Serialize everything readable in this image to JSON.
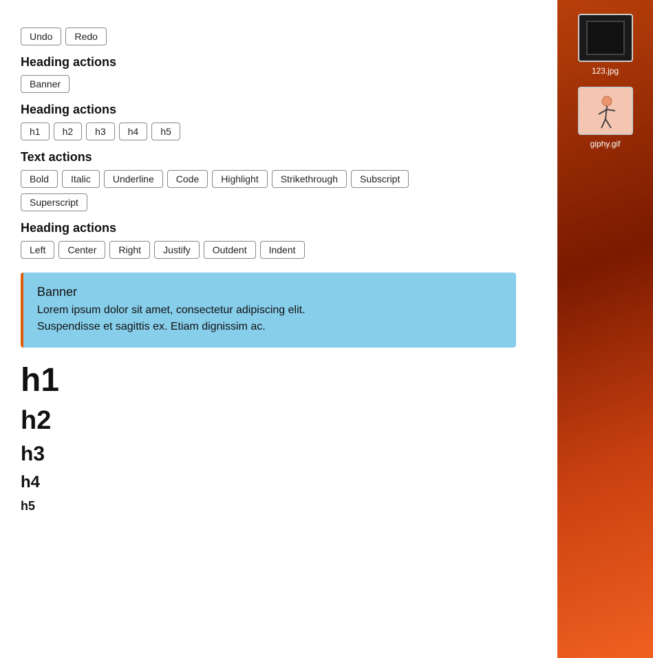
{
  "toolbar": {
    "undo_label": "Undo",
    "redo_label": "Redo"
  },
  "heading_actions_1": {
    "label": "Heading actions",
    "buttons": [
      {
        "label": "Banner",
        "id": "banner-btn"
      }
    ]
  },
  "heading_actions_2": {
    "label": "Heading actions",
    "buttons": [
      {
        "label": "h1"
      },
      {
        "label": "h2"
      },
      {
        "label": "h3"
      },
      {
        "label": "h4"
      },
      {
        "label": "h5"
      }
    ]
  },
  "text_actions": {
    "label": "Text actions",
    "row1": [
      {
        "label": "Bold"
      },
      {
        "label": "Italic"
      },
      {
        "label": "Underline"
      },
      {
        "label": "Code"
      },
      {
        "label": "Highlight"
      },
      {
        "label": "Strikethrough"
      },
      {
        "label": "Subscript"
      }
    ],
    "row2": [
      {
        "label": "Superscript"
      }
    ]
  },
  "heading_actions_3": {
    "label": "Heading actions",
    "buttons": [
      {
        "label": "Left"
      },
      {
        "label": "Center"
      },
      {
        "label": "Right"
      },
      {
        "label": "Justify"
      },
      {
        "label": "Outdent"
      },
      {
        "label": "Indent"
      }
    ]
  },
  "banner": {
    "title": "Banner",
    "text": "Lorem ipsum dolor sit amet, consectetur adipiscing elit.\nSuspendisse et sagittis ex. Etiam dignissim ac."
  },
  "headings": {
    "h1": "h1",
    "h2": "h2",
    "h3": "h3",
    "h4": "h4",
    "h5": "h5"
  },
  "sidebar": {
    "file1": {
      "label": "123.jpg"
    },
    "file2": {
      "label": "giphy.gif"
    }
  }
}
